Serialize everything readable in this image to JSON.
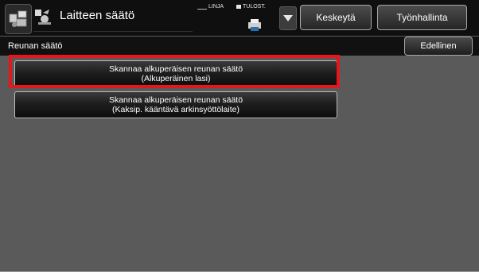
{
  "header": {
    "title": "Laitteen säätö",
    "linja_label": "LINJA",
    "tulost_label": "TULOST.",
    "keskeyta_label": "Keskeytä",
    "tyonhallinta_label": "Työnhallinta"
  },
  "subheader": {
    "title": "Reunan säätö",
    "back_label": "Edellinen"
  },
  "options": [
    {
      "line1": "Skannaa alkuperäisen reunan säätö",
      "line2": "(Alkuperäinen lasi)",
      "highlighted": true
    },
    {
      "line1": "Skannaa alkuperäisen reunan säätö",
      "line2": "(Kaksip. kääntävä arkinsyöttölaite)",
      "highlighted": false
    }
  ],
  "colors": {
    "highlight": "#e3171c",
    "background": "#5a5a5a",
    "bar": "#0f0f0f"
  },
  "icons": [
    "home-icon",
    "settings-icon",
    "printer-icon",
    "dropdown-arrow-icon"
  ]
}
